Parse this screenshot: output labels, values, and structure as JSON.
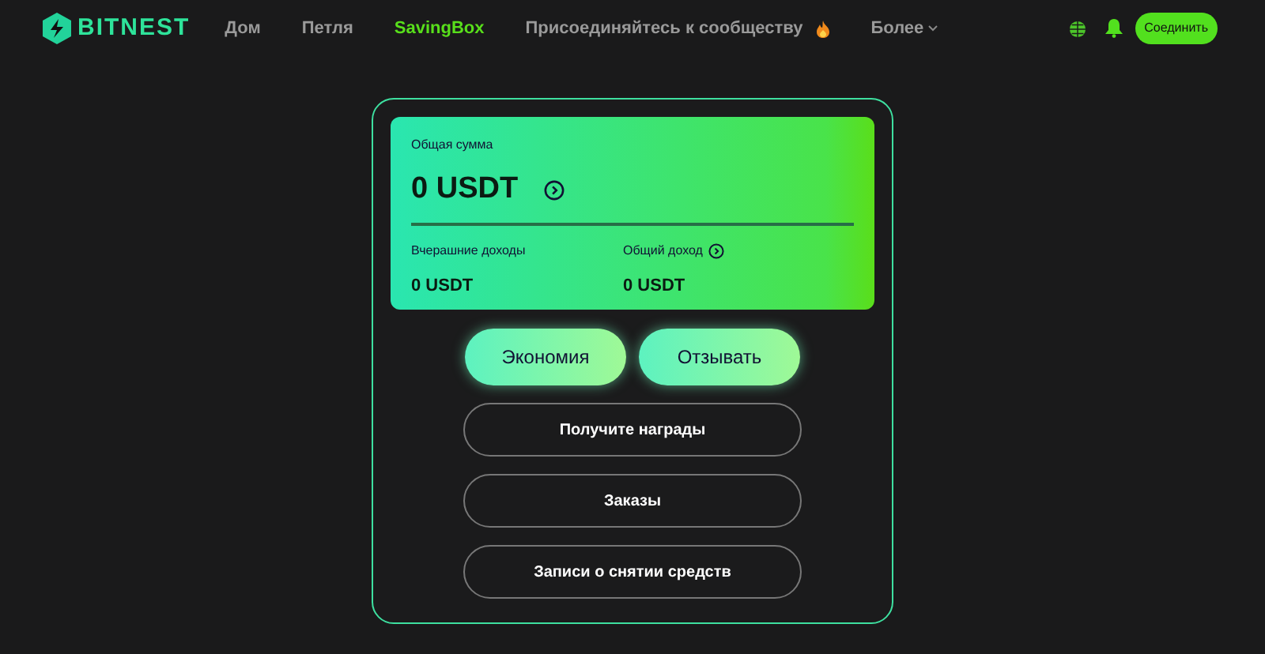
{
  "brand": "BITNEST",
  "nav": [
    {
      "label": "Дом",
      "selected": false
    },
    {
      "label": "Петля",
      "selected": false
    },
    {
      "label": "SavingBox",
      "selected": true
    },
    {
      "label": "Присоединяйтесь к сообществу",
      "selected": false,
      "hot": true
    },
    {
      "label": "Более",
      "selected": false,
      "dropdown": true
    }
  ],
  "connect_button": "Соединить",
  "balance": {
    "label": "Общая сумма",
    "value": "0 USDT",
    "yesterday_label": "Вчерашние доходы",
    "yesterday_value": "0 USDT",
    "total_label": "Общий доход",
    "total_value": "0 USDT"
  },
  "primary_actions": [
    "Экономия",
    "Отзывать"
  ],
  "links": [
    "Получите награды",
    "Заказы",
    "Записи о снятии средств"
  ]
}
